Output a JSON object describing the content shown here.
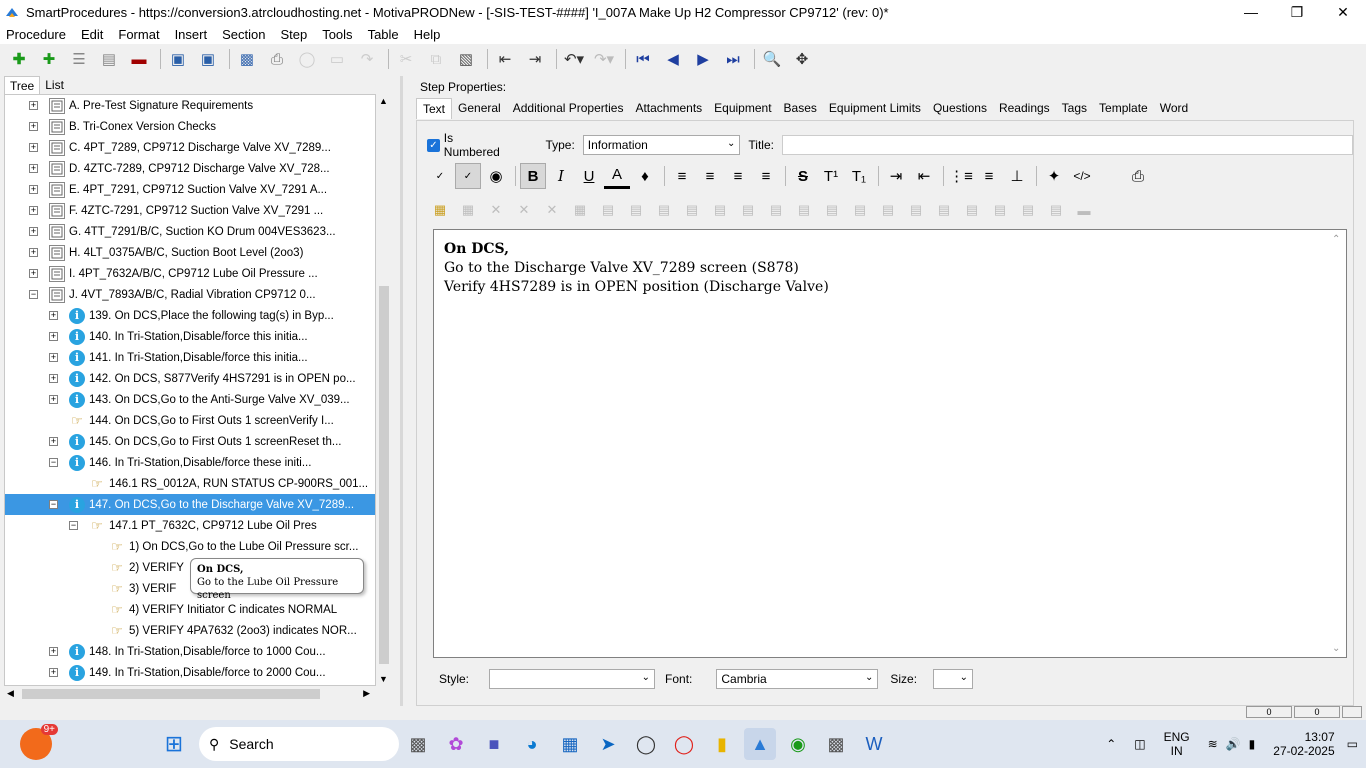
{
  "window": {
    "title": "SmartProcedures - https://conversion3.atrcloudhosting.net - MotivaPRODNew - [-SIS-TEST-####] 'I_007A Make Up H2 Compressor CP9712' (rev: 0)*"
  },
  "menu": [
    "Procedure",
    "Edit",
    "Format",
    "Insert",
    "Section",
    "Step",
    "Tools",
    "Table",
    "Help"
  ],
  "left_tabs": [
    "Tree",
    "List"
  ],
  "tree": [
    {
      "label": "A. Pre-Test Signature Requirements",
      "icon": "doc",
      "level": 0,
      "exp": "+"
    },
    {
      "label": "B. Tri-Conex Version Checks",
      "icon": "doc",
      "level": 0,
      "exp": "+"
    },
    {
      "label": "C. 4PT_7289, CP9712 Discharge Valve XV_7289...",
      "icon": "doc",
      "level": 0,
      "exp": "+"
    },
    {
      "label": "D. 4ZTC-7289, CP9712 Discharge Valve XV_728...",
      "icon": "doc",
      "level": 0,
      "exp": "+"
    },
    {
      "label": "E. 4PT_7291, CP9712 Suction Valve XV_7291 A...",
      "icon": "doc",
      "level": 0,
      "exp": "+"
    },
    {
      "label": "F. 4ZTC-7291, CP9712 Suction Valve XV_7291 ...",
      "icon": "doc",
      "level": 0,
      "exp": "+"
    },
    {
      "label": "G. 4TT_7291/B/C, Suction KO Drum 004VES3623...",
      "icon": "doc",
      "level": 0,
      "exp": "+"
    },
    {
      "label": "H. 4LT_0375A/B/C, Suction Boot Level (2oo3)",
      "icon": "doc",
      "level": 0,
      "exp": "+"
    },
    {
      "label": "I. 4PT_7632A/B/C, CP9712 Lube Oil Pressure ...",
      "icon": "doc",
      "level": 0,
      "exp": "+"
    },
    {
      "label": "J. 4VT_7893A/B/C, Radial Vibration CP9712 0...",
      "icon": "doc",
      "level": 0,
      "exp": "-"
    },
    {
      "label": "139. On DCS,Place the following tag(s) in Byp...",
      "icon": "info",
      "level": 1,
      "exp": "+"
    },
    {
      "label": "140. In Tri-Station,Disable/force this initia...",
      "icon": "info",
      "level": 1,
      "exp": "+"
    },
    {
      "label": "141. In Tri-Station,Disable/force this initia...",
      "icon": "info",
      "level": 1,
      "exp": "+"
    },
    {
      "label": "142. On DCS, S877Verify 4HS7291 is in OPEN po...",
      "icon": "info",
      "level": 1,
      "exp": "+"
    },
    {
      "label": "143. On DCS,Go to the Anti-Surge Valve XV_039...",
      "icon": "info",
      "level": 1,
      "exp": "+"
    },
    {
      "label": "144. On DCS,Go to First Outs 1 screenVerify I...",
      "icon": "hand",
      "level": 1,
      "exp": ""
    },
    {
      "label": "145. On DCS,Go to First Outs 1 screenReset th...",
      "icon": "info",
      "level": 1,
      "exp": "+"
    },
    {
      "label": "146. In Tri-Station,Disable/force these initi...",
      "icon": "info",
      "level": 1,
      "exp": "-"
    },
    {
      "label": "146.1  RS_0012A,  RUN STATUS  CP-900RS_001...",
      "icon": "hand",
      "level": 2,
      "exp": ""
    },
    {
      "label": "147. On DCS,Go to the Discharge Valve XV_7289...",
      "icon": "info",
      "level": 1,
      "exp": "-",
      "selected": true
    },
    {
      "label": "147.1 PT_7632C, CP9712 Lube Oil Pres",
      "icon": "hand",
      "level": 2,
      "exp": "-"
    },
    {
      "label": "1) On DCS,Go to the Lube Oil Pressure scr...",
      "icon": "hand",
      "level": 3,
      "exp": ""
    },
    {
      "label": "2) VERIFY",
      "icon": "hand",
      "level": 3,
      "exp": ""
    },
    {
      "label": "3) VERIF",
      "icon": "hand",
      "level": 3,
      "exp": ""
    },
    {
      "label": "4) VERIFY Initiator C indicates NORMAL",
      "icon": "hand",
      "level": 3,
      "exp": ""
    },
    {
      "label": "5) VERIFY 4PA7632 (2oo3) indicates NOR...",
      "icon": "hand",
      "level": 3,
      "exp": ""
    },
    {
      "label": "148. In Tri-Station,Disable/force to 1000 Cou...",
      "icon": "info",
      "level": 1,
      "exp": "+"
    },
    {
      "label": "149. In Tri-Station,Disable/force to 2000 Cou...",
      "icon": "info",
      "level": 1,
      "exp": "+"
    }
  ],
  "tooltip": {
    "line1": "On DCS,",
    "line2": "Go to the Lube Oil Pressure screen"
  },
  "step_properties": {
    "header": "Step Properties:",
    "tabs": [
      "Text",
      "General",
      "Additional Properties",
      "Attachments",
      "Equipment",
      "Bases",
      "Equipment Limits",
      "Questions",
      "Readings",
      "Tags",
      "Template",
      "Word"
    ],
    "is_numbered_label": "Is Numbered",
    "type_label": "Type:",
    "type_value": "Information",
    "title_label": "Title:",
    "title_value": "",
    "editor_lines": [
      "On DCS,",
      "Go to the Discharge Valve XV_7289 screen (S878)",
      "Verify 4HS7289 is in OPEN position (Discharge Valve)"
    ],
    "style_label": "Style:",
    "style_value": "",
    "font_label": "Font:",
    "font_value": "Cambria",
    "size_label": "Size:",
    "size_value": ""
  },
  "statusbar": [
    "0",
    "0"
  ],
  "taskbar": {
    "search_placeholder": "Search",
    "badge": "9+",
    "lang1": "ENG",
    "lang2": "IN",
    "time": "13:07",
    "date": "27-02-2025"
  }
}
